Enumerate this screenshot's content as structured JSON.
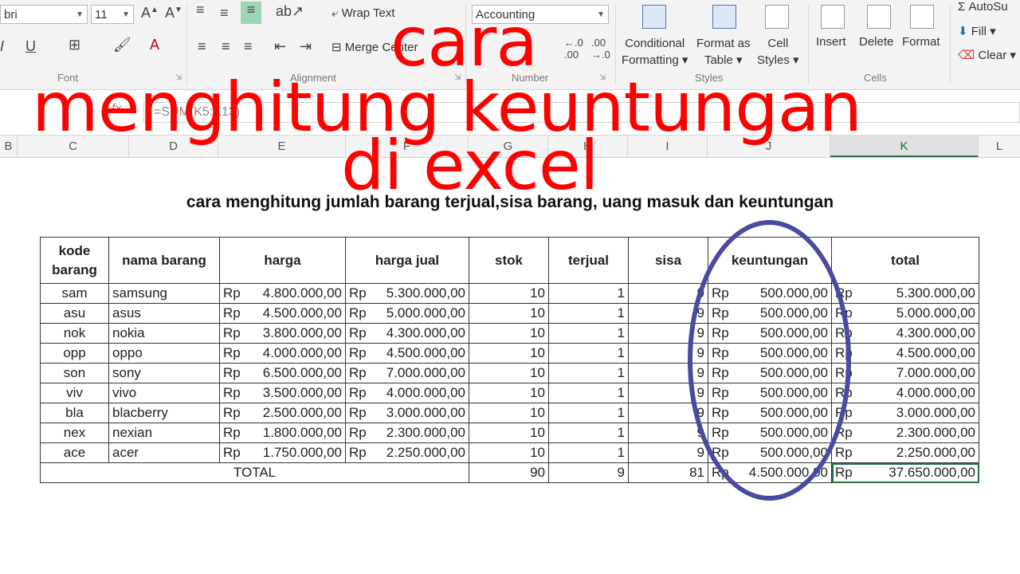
{
  "ribbon": {
    "font_name": "bri",
    "font_size": "11",
    "wrap_text": "Wrap Text",
    "merge": "Merge",
    "center": "Center",
    "number_format": "Accounting",
    "cond_format": [
      "Conditional",
      "Formatting"
    ],
    "format_table": [
      "Format as",
      "Table"
    ],
    "cell_styles": [
      "Cell",
      "Styles"
    ],
    "insert": "Insert",
    "delete": "Delete",
    "format": "Format",
    "autosum": "AutoSu",
    "fill": "Fill",
    "clear": "Clear",
    "groups": {
      "font": "Font",
      "alignment": "Alignment",
      "number": "Number",
      "styles": "Styles",
      "cells": "Cells"
    }
  },
  "formula_bar": {
    "formula": "=SUM(K5:K13)",
    "fx": "fx"
  },
  "columns": [
    "B",
    "C",
    "D",
    "E",
    "F",
    "G",
    "H",
    "I",
    "J",
    "K",
    "L"
  ],
  "overlay_title": [
    "cara",
    "menghitung keuntungan",
    "di excel"
  ],
  "subtitle": "cara menghitung jumlah barang terjual,sisa barang,  uang masuk dan keuntungan",
  "table": {
    "headers": [
      "kode barang",
      "nama barang",
      "harga",
      "harga jual",
      "stok",
      "terjual",
      "sisa",
      "keuntungan",
      "total"
    ],
    "currency": "Rp",
    "rows": [
      [
        "sam",
        "samsung",
        "4.800.000,00",
        "5.300.000,00",
        "10",
        "1",
        "9",
        "500.000,00",
        "5.300.000,00"
      ],
      [
        "asu",
        "asus",
        "4.500.000,00",
        "5.000.000,00",
        "10",
        "1",
        "9",
        "500.000,00",
        "5.000.000,00"
      ],
      [
        "nok",
        "nokia",
        "3.800.000,00",
        "4.300.000,00",
        "10",
        "1",
        "9",
        "500.000,00",
        "4.300.000,00"
      ],
      [
        "opp",
        "oppo",
        "4.000.000,00",
        "4.500.000,00",
        "10",
        "1",
        "9",
        "500.000,00",
        "4.500.000,00"
      ],
      [
        "son",
        "sony",
        "6.500.000,00",
        "7.000.000,00",
        "10",
        "1",
        "9",
        "500.000,00",
        "7.000.000,00"
      ],
      [
        "viv",
        "vivo",
        "3.500.000,00",
        "4.000.000,00",
        "10",
        "1",
        "9",
        "500.000,00",
        "4.000.000,00"
      ],
      [
        "bla",
        "blacberry",
        "2.500.000,00",
        "3.000.000,00",
        "10",
        "1",
        "9",
        "500.000,00",
        "3.000.000,00"
      ],
      [
        "nex",
        "nexian",
        "1.800.000,00",
        "2.300.000,00",
        "10",
        "1",
        "9",
        "500.000,00",
        "2.300.000,00"
      ],
      [
        "ace",
        "acer",
        "1.750.000,00",
        "2.250.000,00",
        "10",
        "1",
        "9",
        "500.000,00",
        "2.250.000,00"
      ]
    ],
    "total": {
      "label": "TOTAL",
      "stok": "90",
      "terjual": "9",
      "sisa": "81",
      "keuntungan": "4.500.000,00",
      "total": "37.650.000,00"
    }
  },
  "colors": {
    "overlay_red": "#ff0000",
    "ellipse_blue": "#4a4aa0",
    "excel_green": "#217346"
  }
}
